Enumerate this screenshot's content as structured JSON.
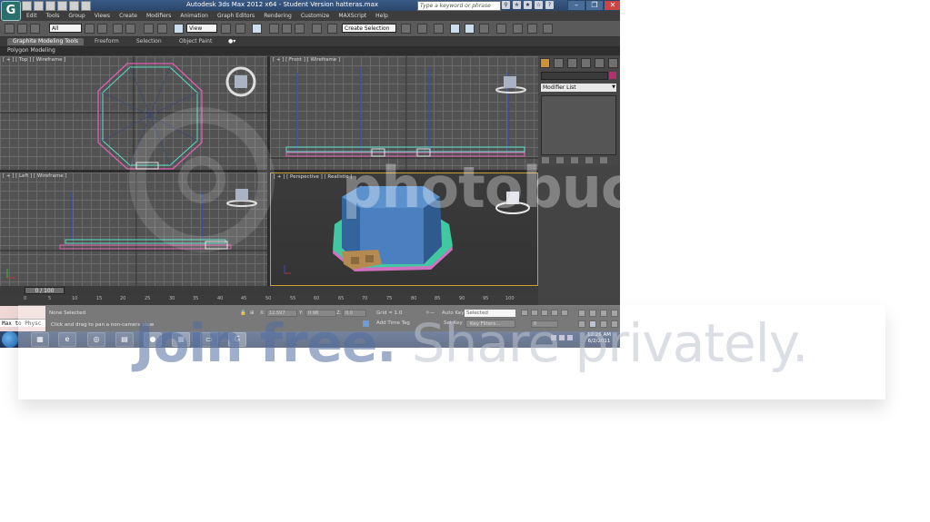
{
  "window": {
    "title": "Autodesk 3ds Max  2012 x64   - Student Version   hatteras.max",
    "search_placeholder": "Type a keyword or phrase",
    "logo_letter": "G"
  },
  "menu": [
    "Edit",
    "Tools",
    "Group",
    "Views",
    "Create",
    "Modifiers",
    "Animation",
    "Graph Editors",
    "Rendering",
    "Customize",
    "MAXScript",
    "Help"
  ],
  "toolbar": {
    "filter_value": "All",
    "refcoord_value": "View",
    "named_selection_value": "Create Selection"
  },
  "ribbon": {
    "tabs": [
      "Graphite Modeling Tools",
      "Freeform",
      "Selection",
      "Object Paint"
    ],
    "active_panel": "Polygon Modeling"
  },
  "viewports": {
    "top": "[ + ] [ Top ] [ Wireframe ]",
    "front": "[ + ] [ Front ] [ Wireframe ]",
    "left": "[ + ] [ Left ] [ Wireframe ]",
    "perspective": "[ + ] [ Perspective ] [ Realistic ]"
  },
  "command_panel": {
    "modifier_list": "Modifier List"
  },
  "timeline": {
    "slider": "0 / 100",
    "ticks": [
      "0",
      "5",
      "10",
      "15",
      "20",
      "25",
      "30",
      "35",
      "40",
      "45",
      "50",
      "55",
      "60",
      "65",
      "70",
      "75",
      "80",
      "85",
      "90",
      "95",
      "100"
    ]
  },
  "status": {
    "maxscript": "Max to Physc",
    "selection": "None Selected",
    "prompt": "Click and drag to pan a non-camera view",
    "x_label": "X:",
    "x_value": "12.597",
    "y_label": "Y:",
    "y_value": "0.98",
    "z_label": "Z:",
    "z_value": "0.0",
    "grid": "Grid = 1.0",
    "add_time_tag": "Add Time Tag",
    "auto_key": "Auto Key",
    "selected": "Selected",
    "set_key": "Set Key",
    "key_filters": "Key Filters...",
    "frame": "0"
  },
  "taskbar": {
    "time": "12:26 AM",
    "date": "6/2/2011"
  },
  "watermark": {
    "logo": "photobucket",
    "text_bold": "Join free.",
    "text_rest": " Share privately."
  },
  "colors": {
    "selection_pink": "#e060b0",
    "object_cyan": "#58e0c8",
    "object_blue": "#4a7fc0",
    "active_viewport_border": "#c8a030"
  }
}
